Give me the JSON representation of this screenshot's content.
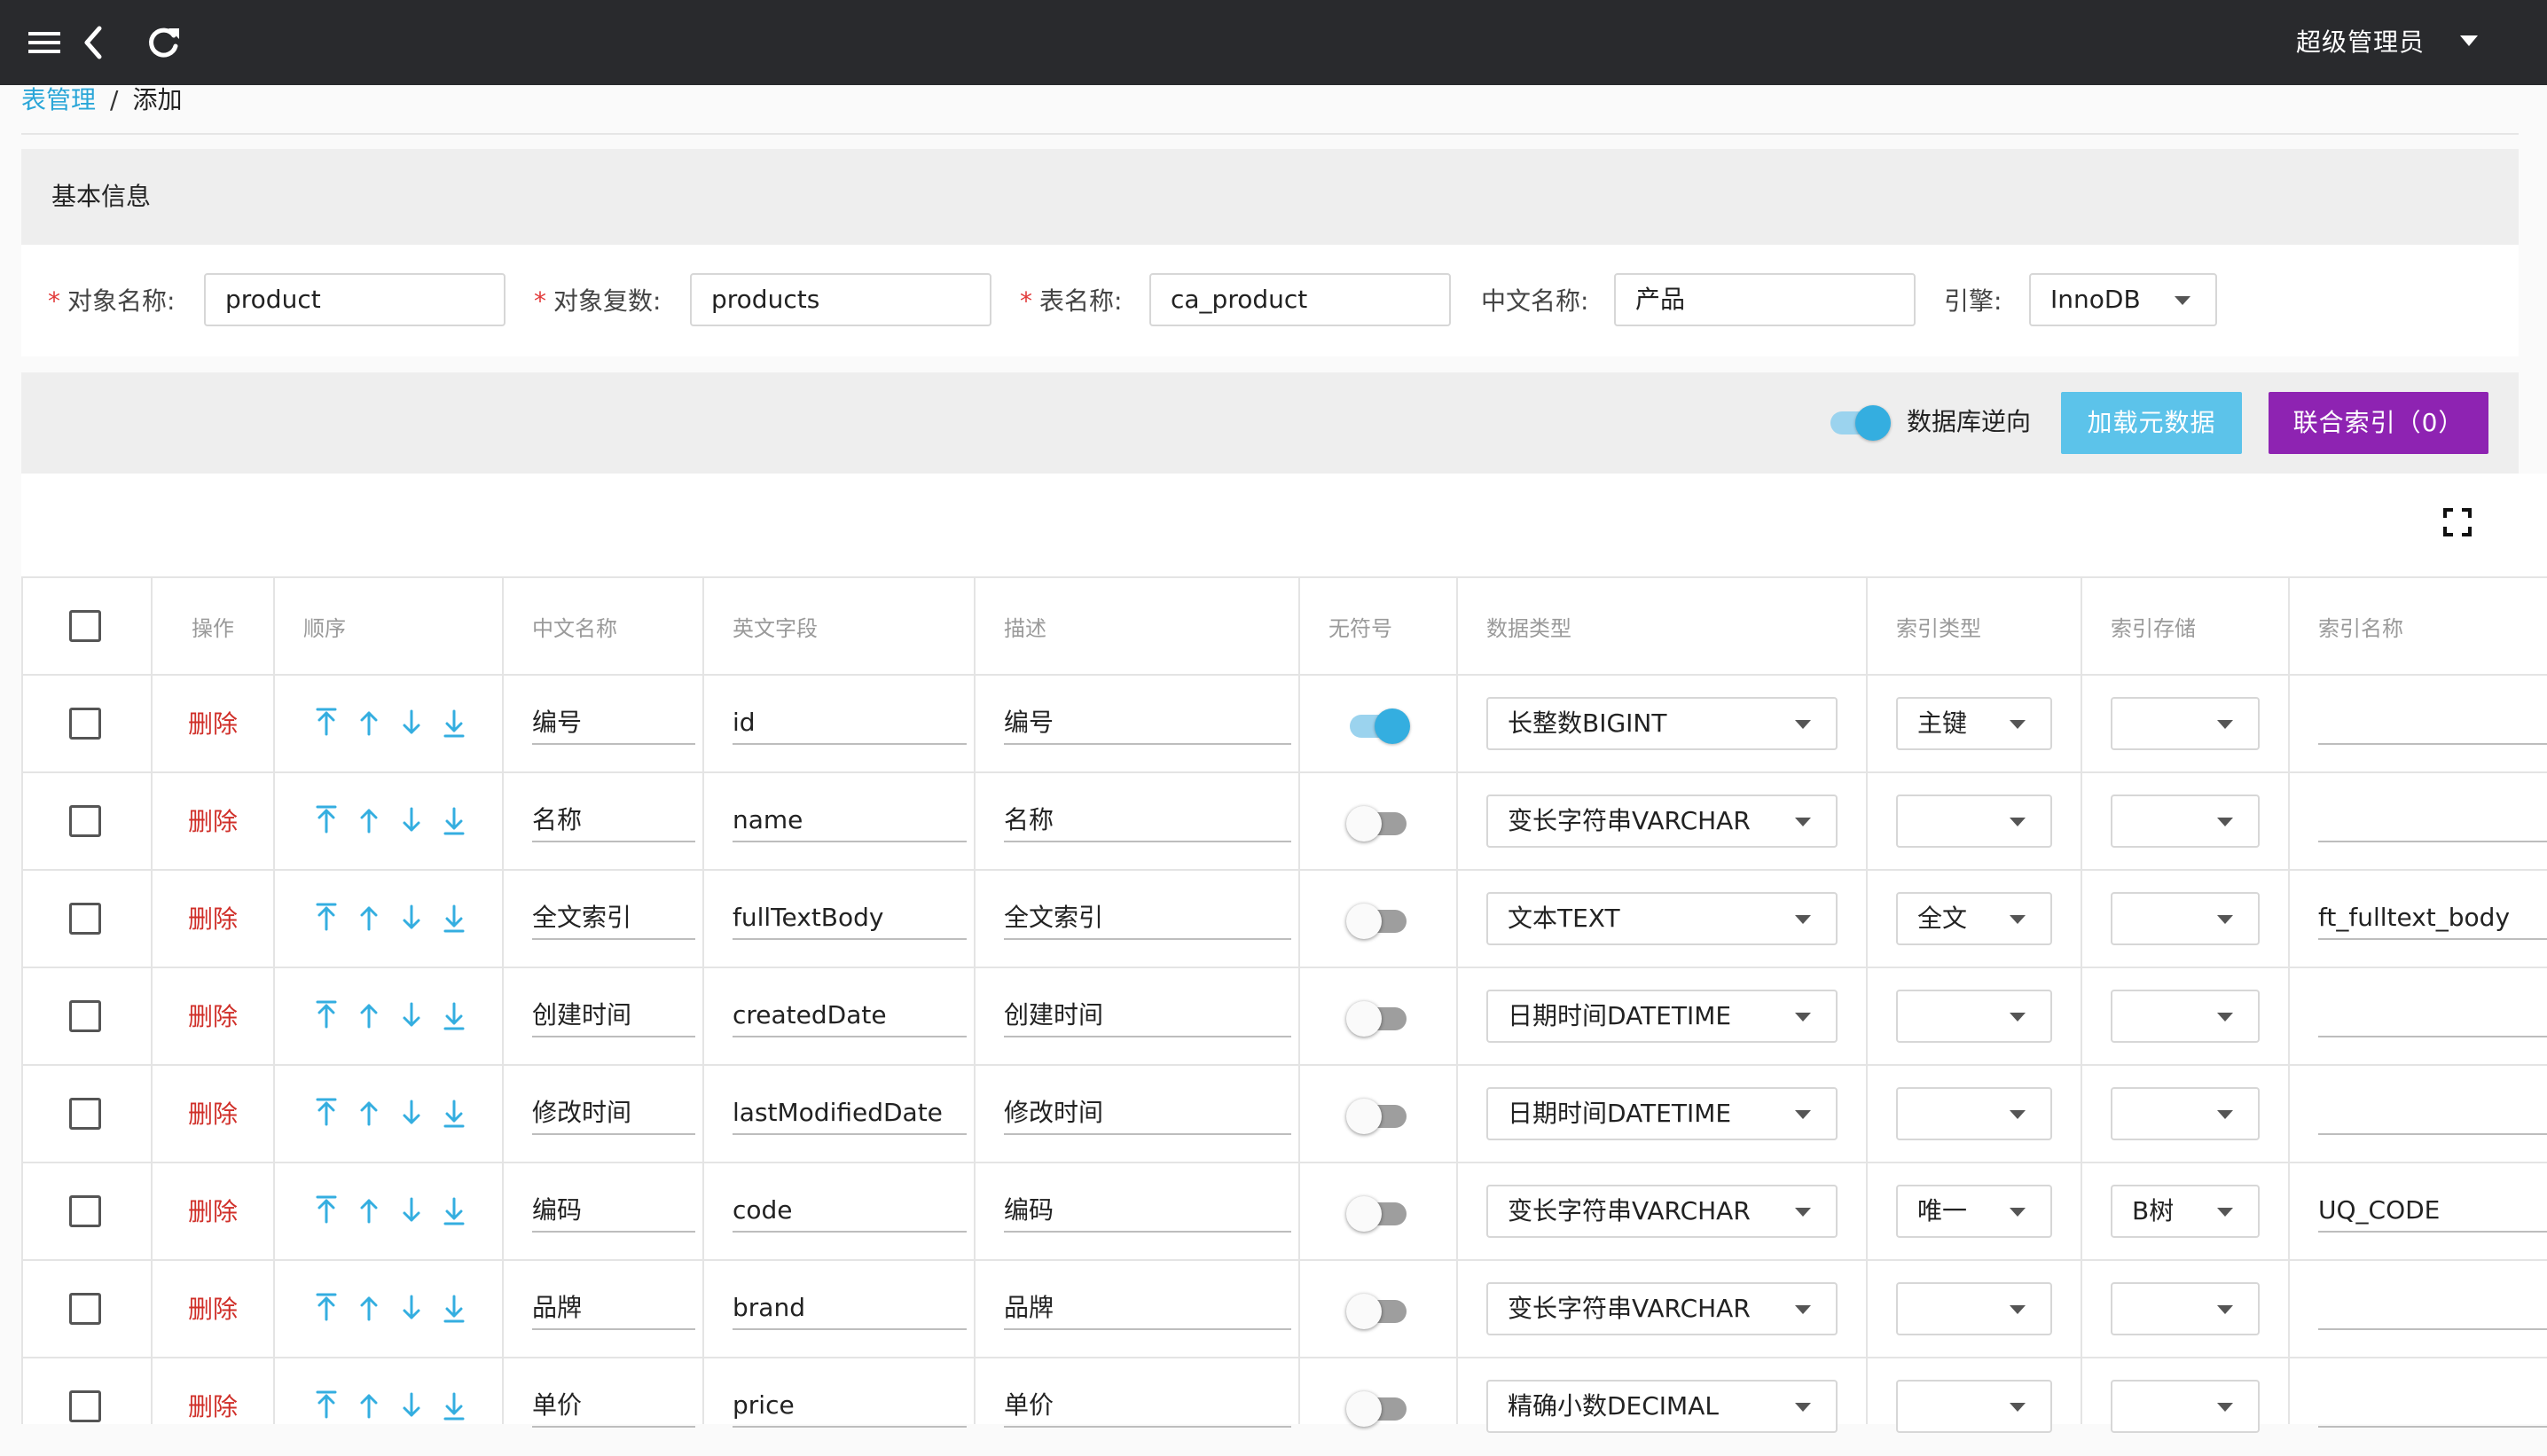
{
  "header": {
    "user_label": "超级管理员",
    "icons": [
      "menu-icon",
      "back-icon",
      "refresh-icon",
      "caret-down-icon"
    ]
  },
  "breadcrumb": {
    "parent": "表管理",
    "separator": "/",
    "current": "添加"
  },
  "basic_info": {
    "title": "基本信息",
    "fields": {
      "object_name": {
        "label": "对象名称:",
        "value": "product",
        "required": true
      },
      "object_plural": {
        "label": "对象复数:",
        "value": "products",
        "required": true
      },
      "table_name": {
        "label": "表名称:",
        "value": "ca_product",
        "required": true
      },
      "cn_name": {
        "label": "中文名称:",
        "value": "产品",
        "required": false
      },
      "engine": {
        "label": "引擎:",
        "value": "InnoDB",
        "required": false
      }
    }
  },
  "toolbar": {
    "reverse_label": "数据库逆向",
    "reverse_on": true,
    "load_metadata_label": "加载元数据",
    "composite_index_label": "联合索引（0）"
  },
  "colors": {
    "accent": "#34aee0",
    "purple": "#8e23b2",
    "danger": "#d0302a",
    "topbar": "#292a2d"
  },
  "table": {
    "headers": {
      "action": "操作",
      "order": "顺序",
      "cn_name": "中文名称",
      "en_field": "英文字段",
      "desc": "描述",
      "unsigned": "无符号",
      "data_type": "数据类型",
      "index_type": "索引类型",
      "index_storage": "索引存储",
      "index_name": "索引名称"
    },
    "delete_label": "删除",
    "rows": [
      {
        "cn": "编号",
        "en": "id",
        "desc": "编号",
        "unsigned": true,
        "type": "长整数BIGINT",
        "index_type": "主键",
        "index_storage": "",
        "index_name": ""
      },
      {
        "cn": "名称",
        "en": "name",
        "desc": "名称",
        "unsigned": false,
        "type": "变长字符串VARCHAR",
        "index_type": "",
        "index_storage": "",
        "index_name": ""
      },
      {
        "cn": "全文索引",
        "en": "fullTextBody",
        "desc": "全文索引",
        "unsigned": false,
        "type": "文本TEXT",
        "index_type": "全文",
        "index_storage": "",
        "index_name": "ft_fulltext_body"
      },
      {
        "cn": "创建时间",
        "en": "createdDate",
        "desc": "创建时间",
        "unsigned": false,
        "type": "日期时间DATETIME",
        "index_type": "",
        "index_storage": "",
        "index_name": ""
      },
      {
        "cn": "修改时间",
        "en": "lastModifiedDate",
        "desc": "修改时间",
        "unsigned": false,
        "type": "日期时间DATETIME",
        "index_type": "",
        "index_storage": "",
        "index_name": ""
      },
      {
        "cn": "编码",
        "en": "code",
        "desc": "编码",
        "unsigned": false,
        "type": "变长字符串VARCHAR",
        "index_type": "唯一",
        "index_storage": "B树",
        "index_name": "UQ_CODE"
      },
      {
        "cn": "品牌",
        "en": "brand",
        "desc": "品牌",
        "unsigned": false,
        "type": "变长字符串VARCHAR",
        "index_type": "",
        "index_storage": "",
        "index_name": ""
      },
      {
        "cn": "单价",
        "en": "price",
        "desc": "单价",
        "unsigned": false,
        "type": "精确小数DECIMAL",
        "index_type": "",
        "index_storage": "",
        "index_name": ""
      }
    ]
  }
}
